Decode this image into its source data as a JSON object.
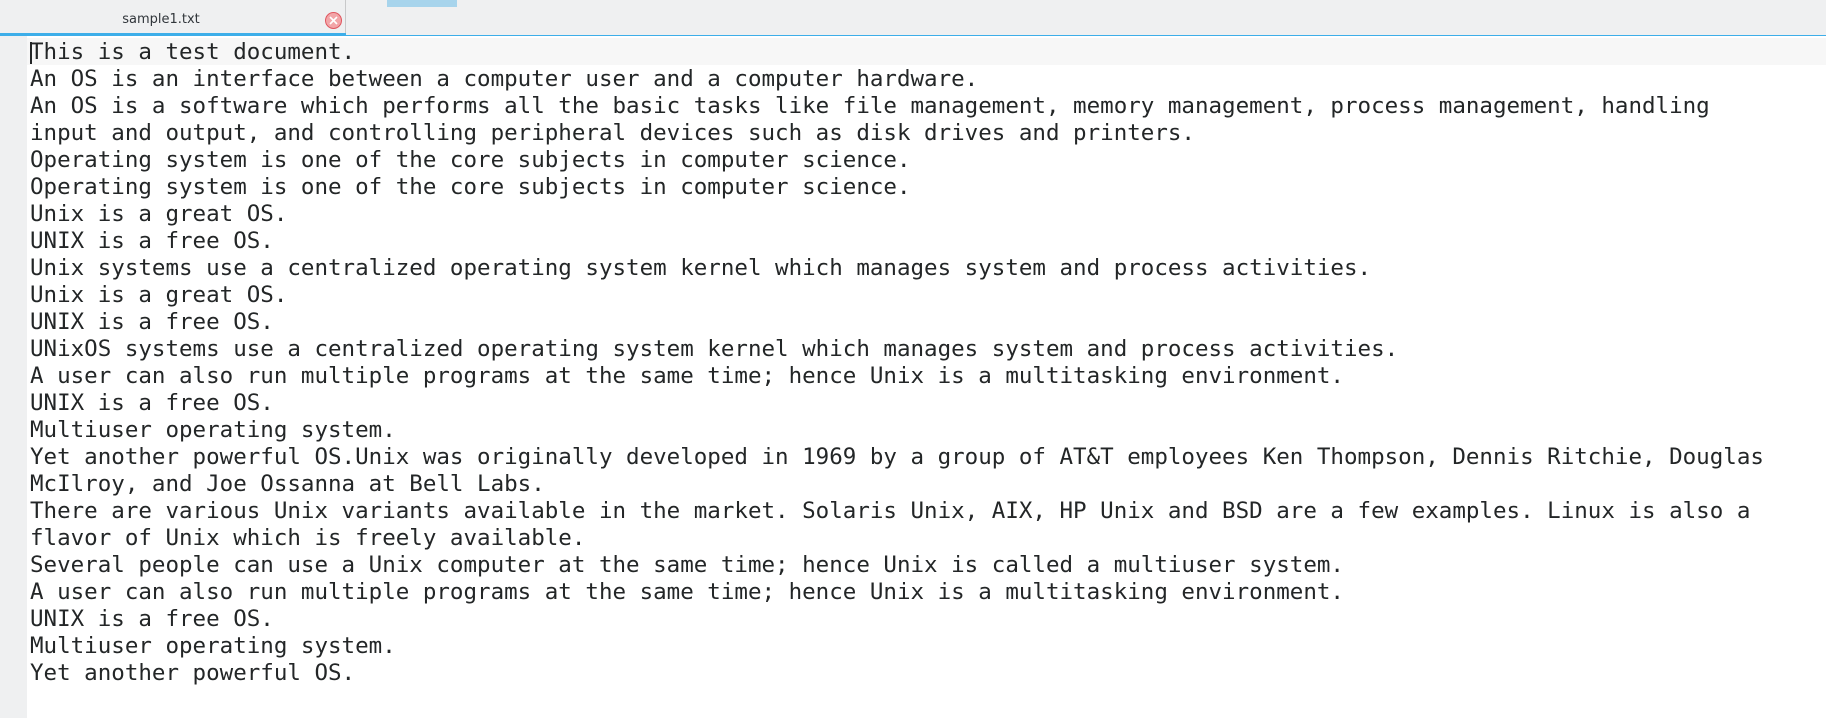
{
  "tabs": [
    {
      "label": "sample1.txt",
      "active": true
    }
  ],
  "colors": {
    "accent": "#3daee9",
    "close": "#e0565f"
  },
  "icons": {
    "close": "close-icon"
  },
  "document": {
    "lines": [
      "This is a test document.",
      "An OS is an interface between a computer user and a computer hardware.",
      "An OS is a software which performs all the basic tasks like file management, memory management, process management, handling",
      "input and output, and controlling peripheral devices such as disk drives and printers.",
      "Operating system is one of the core subjects in computer science.",
      "Operating system is one of the core subjects in computer science.",
      "Unix is a great OS.",
      "UNIX is a free OS.",
      "Unix systems use a centralized operating system kernel which manages system and process activities.",
      "Unix is a great OS.",
      "UNIX is a free OS.",
      "UNixOS systems use a centralized operating system kernel which manages system and process activities.",
      "A user can also run multiple programs at the same time; hence Unix is a multitasking environment.",
      "UNIX is a free OS.",
      "Multiuser operating system.",
      "Yet another powerful OS.Unix was originally developed in 1969 by a group of AT&T employees Ken Thompson, Dennis Ritchie, Douglas",
      "McIlroy, and Joe Ossanna at Bell Labs.",
      "There are various Unix variants available in the market. Solaris Unix, AIX, HP Unix and BSD are a few examples. Linux is also a",
      "flavor of Unix which is freely available.",
      "Several people can use a Unix computer at the same time; hence Unix is called a multiuser system.",
      "A user can also run multiple programs at the same time; hence Unix is a multitasking environment.",
      "UNIX is a free OS.",
      "Multiuser operating system.",
      "Yet another powerful OS."
    ]
  }
}
